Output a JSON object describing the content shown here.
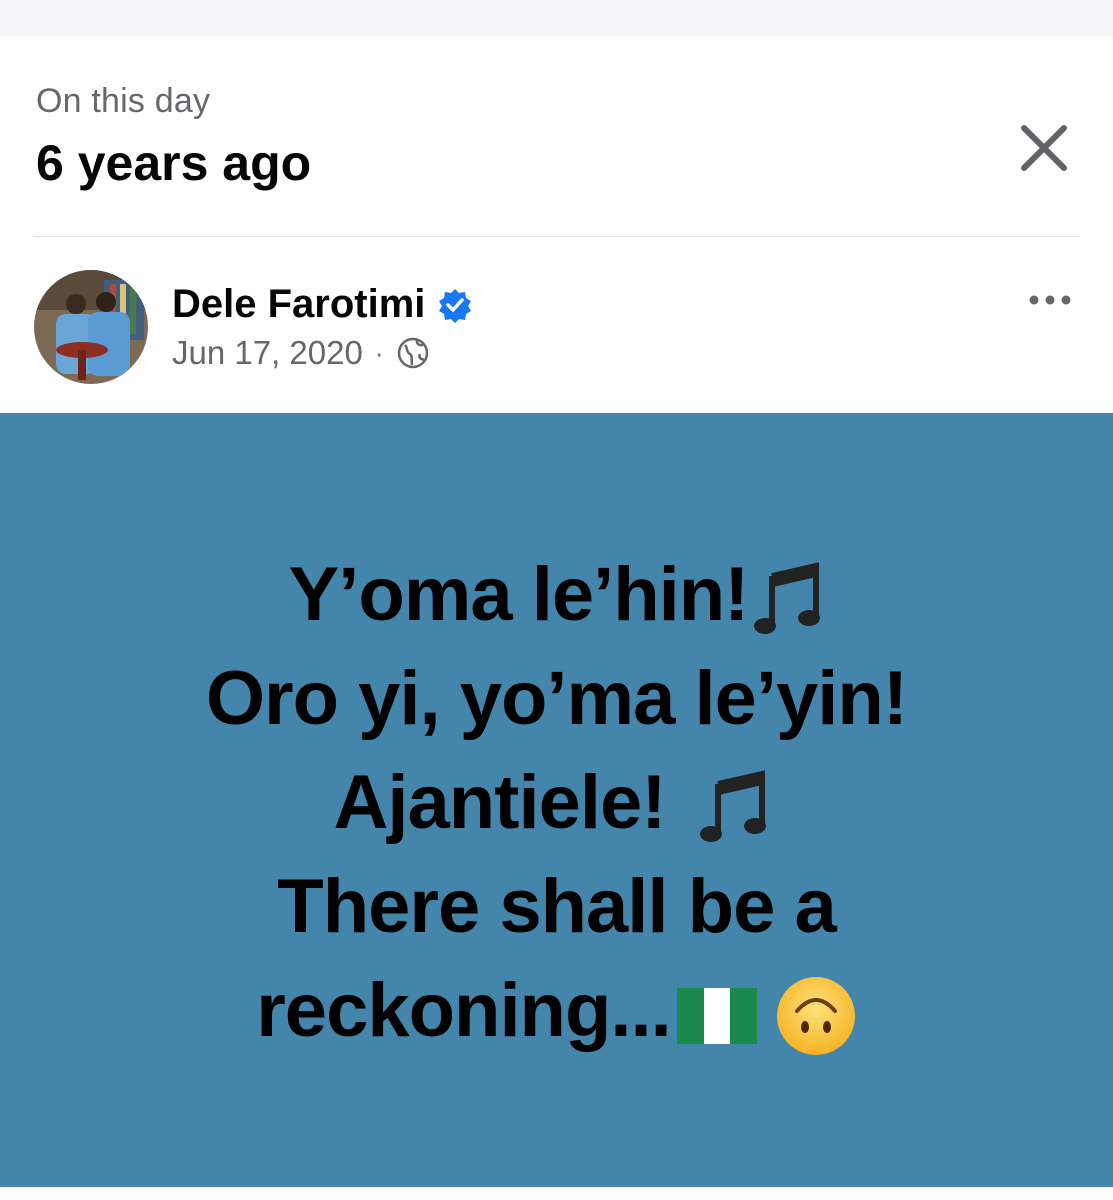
{
  "memory": {
    "label": "On this day",
    "title": "6 years ago"
  },
  "post": {
    "author": "Dele Farotimi",
    "verified": true,
    "date": "Jun 17, 2020",
    "separator": "·",
    "audience_icon": "globe-icon",
    "background_color": "#4485ab",
    "lines": [
      {
        "text": "Y’oma le’hin!",
        "emoji": "music-notes-icon"
      },
      {
        "text": "Oro yi, yo’ma le’yin!",
        "emoji": ""
      },
      {
        "text": "Ajantiele!",
        "emoji": "music-notes-icon"
      },
      {
        "text": "There shall be a",
        "emoji": ""
      },
      {
        "text": "reckoning...",
        "emoji": "nigeria-flag-icon upside-down-face-icon"
      }
    ]
  },
  "icons": {
    "close": "close-icon",
    "more": "more-options-icon",
    "verified": "verified-badge-icon"
  },
  "colors": {
    "accent_blue": "#1877f2",
    "post_background": "#4485ab",
    "secondary_text": "#65676b"
  }
}
